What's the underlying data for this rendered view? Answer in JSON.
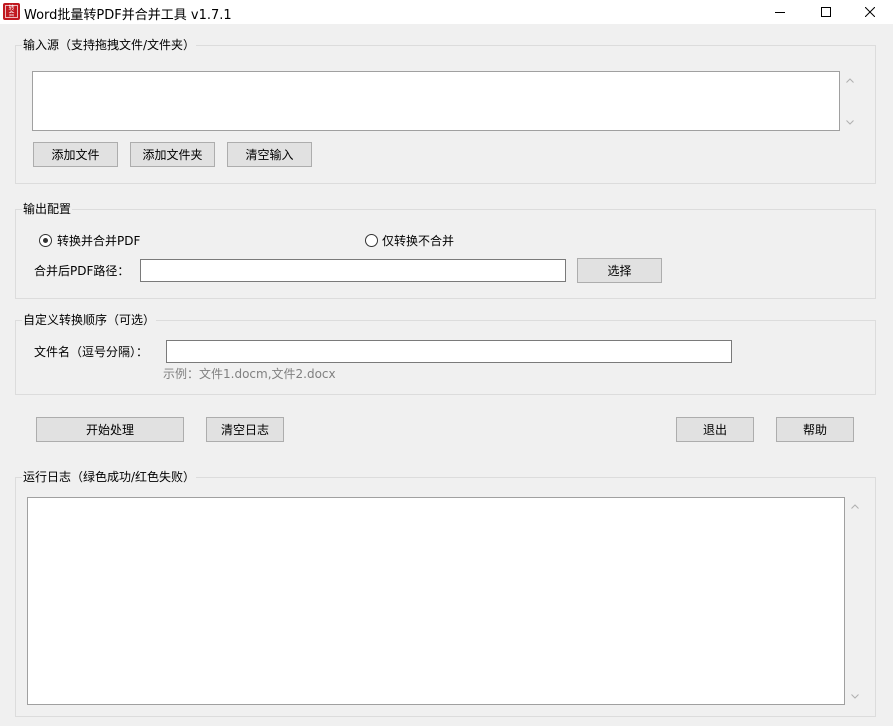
{
  "window": {
    "title": "Word批量转PDF并合并工具 v1.7.1",
    "icon_text": "转合",
    "minimize_icon": "minimize-icon",
    "maximize_icon": "maximize-icon",
    "close_icon": "close-icon"
  },
  "input_source": {
    "label": "输入源（支持拖拽文件/文件夹）",
    "textarea_value": "",
    "buttons": {
      "add_file": "添加文件",
      "add_folder": "添加文件夹",
      "clear_input": "清空输入"
    }
  },
  "output_config": {
    "label": "输出配置",
    "radio_merge": "转换并合并PDF",
    "radio_merge_checked": true,
    "radio_convert_only": "仅转换不合并",
    "radio_convert_only_checked": false,
    "merged_path_label": "合并后PDF路径：",
    "merged_path_value": "",
    "select_button": "选择"
  },
  "custom_order": {
    "label": "自定义转换顺序（可选）",
    "filename_label": "文件名（逗号分隔）：",
    "filename_value": "",
    "example_hint": "示例：文件1.docm,文件2.docx"
  },
  "actions": {
    "start": "开始处理",
    "clear_log": "清空日志",
    "exit": "退出",
    "help": "帮助"
  },
  "log": {
    "label": "运行日志（绿色成功/红色失败）",
    "content": ""
  },
  "colors": {
    "window_bg": "#f0f0f0",
    "button_bg": "#e1e1e1",
    "icon_red": "#c0181f"
  }
}
